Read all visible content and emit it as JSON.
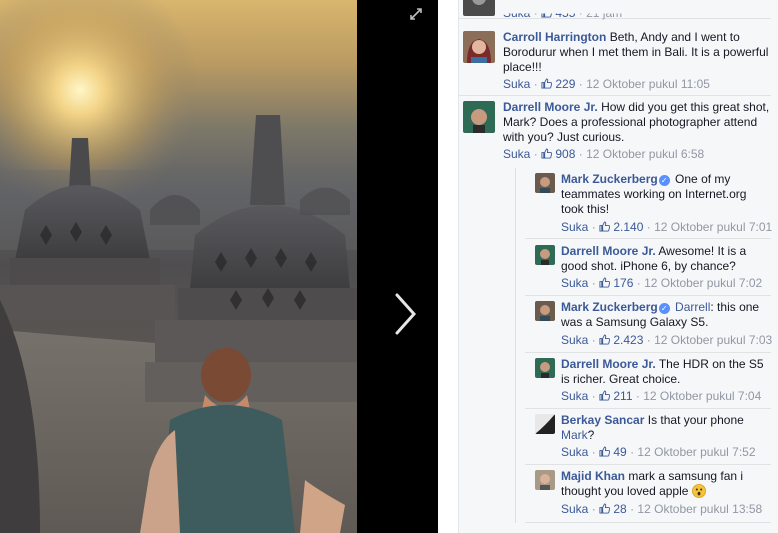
{
  "photo": {
    "alt": "Person sitting in front of stupas at sunrise"
  },
  "icons": {
    "expand": "expand-icon",
    "next": "chevron-right-icon",
    "like": "thumbs-up-icon",
    "verified": "verified-badge-icon"
  },
  "colors": {
    "link": "#3b5998",
    "meta": "#9197a3",
    "verified": "#5890ff",
    "panel_bg": "#f6f7f9"
  },
  "top_partial": {
    "like": "Suka",
    "count": "455",
    "time": "21 jam"
  },
  "comments": [
    {
      "author": "Carroll Harrington",
      "text": "Beth, Andy and I went to Borodurur when I met them in Bali. It is a powerful place!!!",
      "like": "Suka",
      "count": "229",
      "time": "12 Oktober pukul 11:05"
    },
    {
      "author": "Darrell Moore Jr.",
      "text": "How did you get this great shot, Mark? Does a professional photographer attend with you? Just curious.",
      "like": "Suka",
      "count": "908",
      "time": "12 Oktober pukul 6:58"
    }
  ],
  "replies": [
    {
      "author": "Mark Zuckerberg",
      "text": "One of my teammates working on Internet.org took this!",
      "like": "Suka",
      "count": "2.140",
      "time": "12 Oktober pukul 7:01"
    },
    {
      "author": "Darrell Moore Jr.",
      "text": "Awesome! It is a good shot. iPhone 6, by chance?",
      "like": "Suka",
      "count": "176",
      "time": "12 Oktober pukul 7:02"
    },
    {
      "author": "Mark Zuckerberg",
      "mention": "Darrell",
      "text": ": this one was a Samsung Galaxy S5.",
      "like": "Suka",
      "count": "2.423",
      "time": "12 Oktober pukul 7:03"
    },
    {
      "author": "Darrell Moore Jr.",
      "text": "The HDR on the S5 is richer. Great choice.",
      "like": "Suka",
      "count": "211",
      "time": "12 Oktober pukul 7:04"
    },
    {
      "author": "Berkay Sancar",
      "text": "Is that your phone",
      "mention": "Mark",
      "text2": "?",
      "like": "Suka",
      "count": "49",
      "time": "12 Oktober pukul 7:52"
    },
    {
      "author": "Majid Khan",
      "text": "mark a samsung fan i thought you loved apple",
      "like": "Suka",
      "count": "28",
      "time": "12 Oktober pukul 13:58"
    }
  ]
}
